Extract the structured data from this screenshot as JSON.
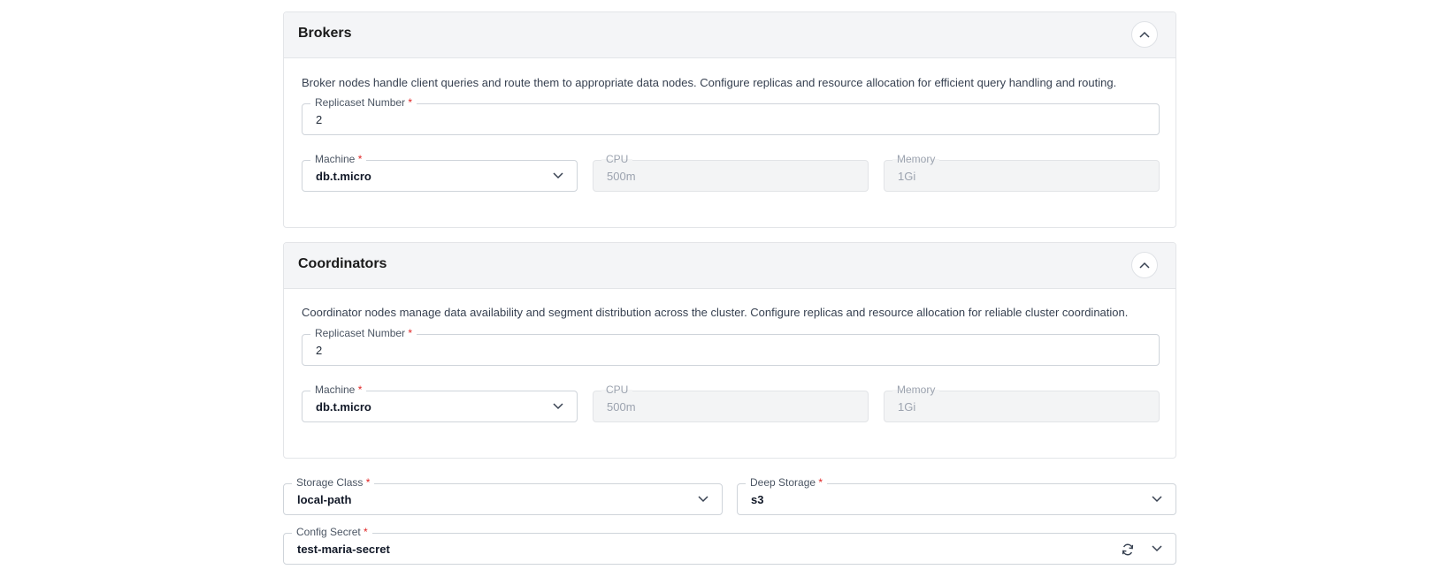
{
  "brokers": {
    "title": "Brokers",
    "description": "Broker nodes handle client queries and route them to appropriate data nodes. Configure replicas and resource allocation for efficient query handling and routing.",
    "replicas": {
      "label": "Replicaset Number",
      "required": "*",
      "value": "2"
    },
    "machine": {
      "label": "Machine",
      "required": "*",
      "value": "db.t.micro"
    },
    "cpu": {
      "label": "CPU",
      "value": "500m"
    },
    "memory": {
      "label": "Memory",
      "value": "1Gi"
    }
  },
  "coordinators": {
    "title": "Coordinators",
    "description": "Coordinator nodes manage data availability and segment distribution across the cluster. Configure replicas and resource allocation for reliable cluster coordination.",
    "replicas": {
      "label": "Replicaset Number",
      "required": "*",
      "value": "2"
    },
    "machine": {
      "label": "Machine",
      "required": "*",
      "value": "db.t.micro"
    },
    "cpu": {
      "label": "CPU",
      "value": "500m"
    },
    "memory": {
      "label": "Memory",
      "value": "1Gi"
    }
  },
  "storage_class": {
    "label": "Storage Class",
    "required": "*",
    "value": "local-path"
  },
  "deep_storage": {
    "label": "Deep Storage",
    "required": "*",
    "value": "s3"
  },
  "config_secret": {
    "label": "Config Secret",
    "required": "*",
    "value": "test-maria-secret"
  },
  "icons": {
    "collapse": "chevron-up-icon",
    "dropdown": "chevron-down-icon",
    "refresh": "refresh-icon"
  },
  "colors": {
    "required": "#e02424",
    "header_bg": "#f4f5f7",
    "border": "#cfd4da"
  }
}
